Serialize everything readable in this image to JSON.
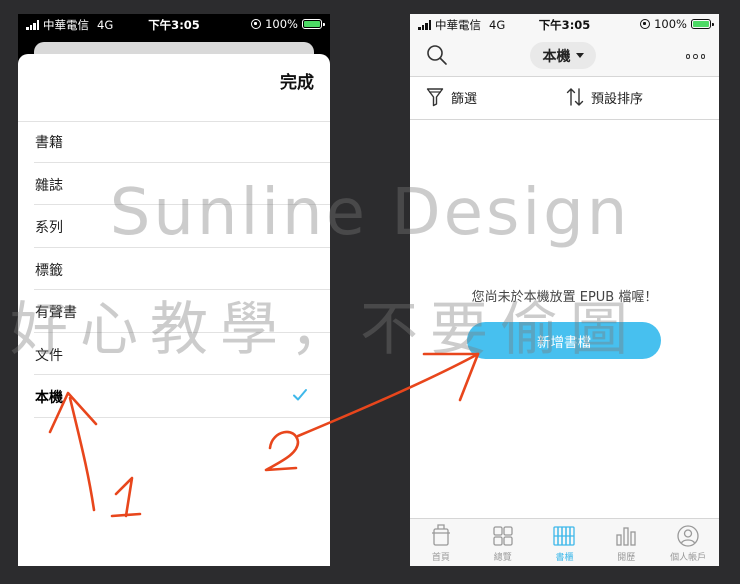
{
  "left": {
    "status": {
      "carrier": "中華電信",
      "network": "4G",
      "time": "下午3:05",
      "battery": "100%"
    },
    "done_label": "完成",
    "items": [
      {
        "label": "書籍"
      },
      {
        "label": "雜誌"
      },
      {
        "label": "系列"
      },
      {
        "label": "標籤"
      },
      {
        "label": "有聲書"
      },
      {
        "label": "文件"
      },
      {
        "label": "本機"
      }
    ],
    "selected_item": "本機"
  },
  "right": {
    "status": {
      "carrier": "中華電信",
      "network": "4G",
      "time": "下午3:05",
      "battery": "100%"
    },
    "source_label": "本機",
    "filter_label": "篩選",
    "sort_label": "預設排序",
    "empty_message": "您尚未於本機放置 EPUB 檔喔！",
    "add_button": "新增書檔",
    "tabs": [
      {
        "label": "首頁",
        "icon": "home-icon"
      },
      {
        "label": "總覽",
        "icon": "grid-icon"
      },
      {
        "label": "書櫃",
        "icon": "bookshelf-icon"
      },
      {
        "label": "閱歷",
        "icon": "bar-chart-icon"
      },
      {
        "label": "個人帳戶",
        "icon": "account-icon"
      }
    ],
    "active_tab": "書櫃"
  },
  "watermark": {
    "line1": "Sunline Design",
    "line2": "好心教學，不要偷圖"
  },
  "annotations": {
    "step1": "1",
    "step2": "2",
    "color": "#e8461c"
  },
  "colors": {
    "accent": "#47c0ef",
    "check": "#3fb8ea",
    "background": "#2c2c2e"
  }
}
